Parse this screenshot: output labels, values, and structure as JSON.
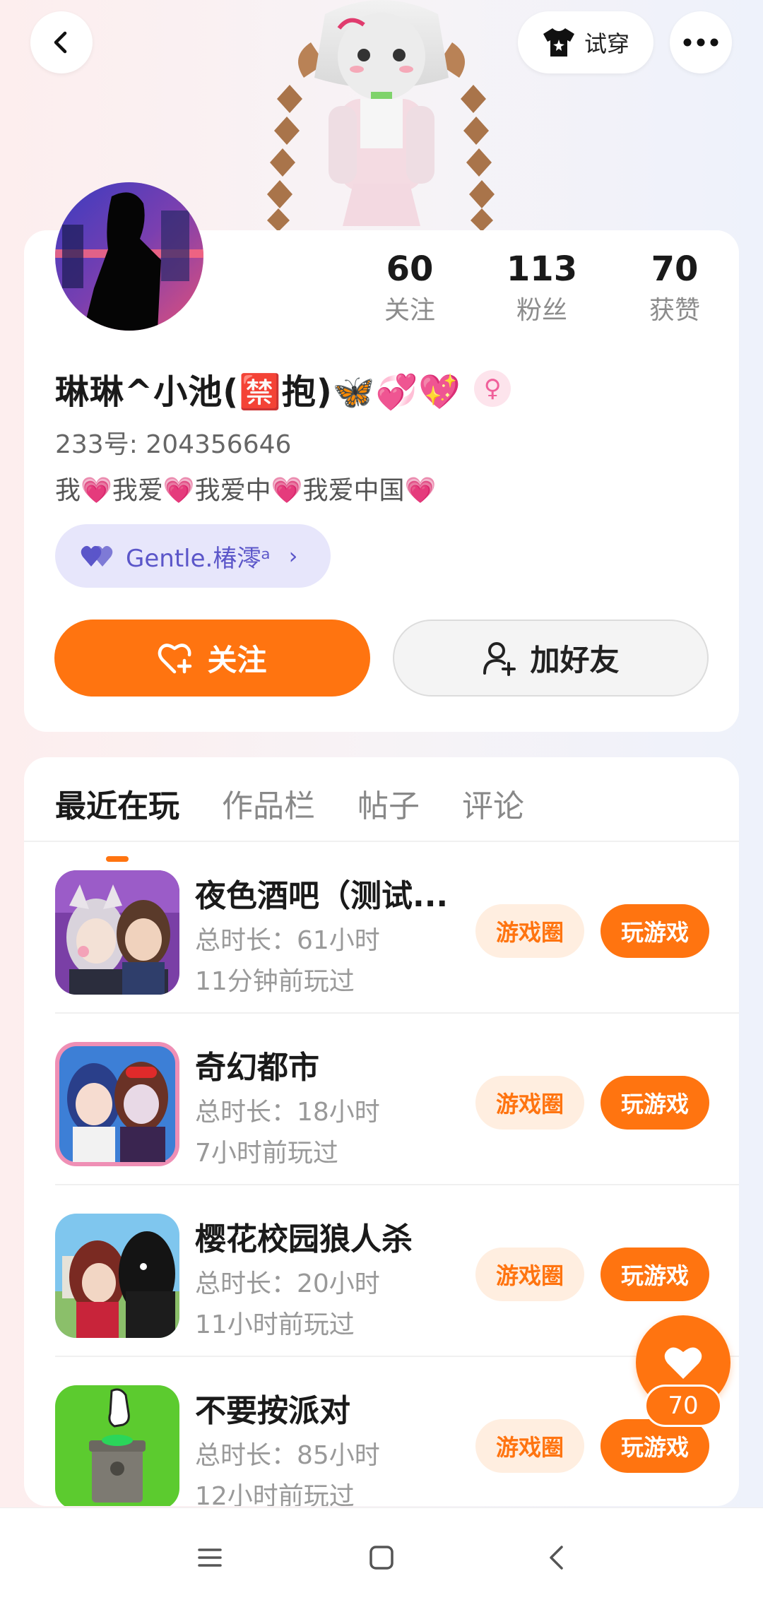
{
  "header": {
    "tryon_label": "试穿"
  },
  "profile": {
    "stats": [
      {
        "value": "60",
        "label": "关注"
      },
      {
        "value": "113",
        "label": "粉丝"
      },
      {
        "value": "70",
        "label": "获赞"
      }
    ],
    "nickname": "琳琳^小池(🈲抱)🦋💞💖",
    "gender_icon": "female-icon",
    "uid": "233号: 204356646",
    "bio": "我💗我爱💗我爱中💗我爱中国💗",
    "tag_label": "Gentle.椿澪ᵃ",
    "follow_label": "关注",
    "add_friend_label": "加好友"
  },
  "tabs": [
    {
      "label": "最近在玩",
      "active": true
    },
    {
      "label": "作品栏",
      "active": false
    },
    {
      "label": "帖子",
      "active": false
    },
    {
      "label": "评论",
      "active": false
    }
  ],
  "games": [
    {
      "title": "夜色酒吧（测试...",
      "duration": "总时长：61小时",
      "last_played": "11分钟前玩过",
      "circle_label": "游戏圈",
      "play_label": "玩游戏"
    },
    {
      "title": "奇幻都市",
      "duration": "总时长：18小时",
      "last_played": "7小时前玩过",
      "circle_label": "游戏圈",
      "play_label": "玩游戏"
    },
    {
      "title": "樱花校园狼人杀",
      "duration": "总时长：20小时",
      "last_played": "11小时前玩过",
      "circle_label": "游戏圈",
      "play_label": "玩游戏"
    },
    {
      "title": "不要按派对",
      "duration": "总时长：85小时",
      "last_played": "12小时前玩过",
      "circle_label": "游戏圈",
      "play_label": "玩游戏"
    }
  ],
  "floating_like": {
    "count": "70"
  },
  "colors": {
    "accent": "#ff7410",
    "accent_light": "#ffeee0",
    "tag_bg": "#e7e6fb",
    "tag_text": "#5b56c9"
  }
}
